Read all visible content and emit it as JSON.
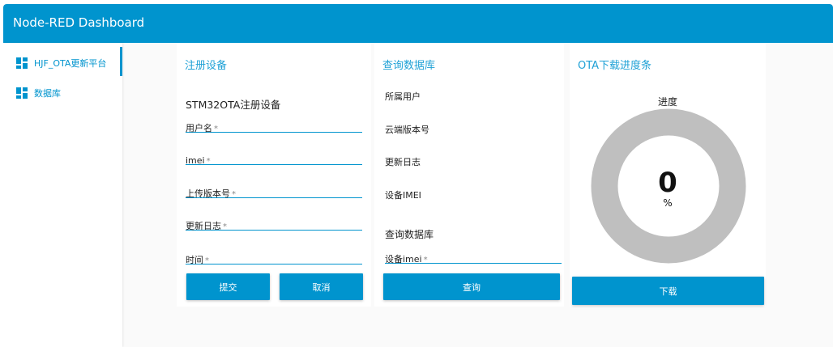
{
  "header": {
    "title": "Node-RED Dashboard"
  },
  "sidebar": {
    "items": [
      {
        "label": "HJF_OTA更新平台",
        "icon": "dashboard-icon",
        "active": true
      },
      {
        "label": "数据库",
        "icon": "dashboard-icon",
        "active": false
      }
    ]
  },
  "register": {
    "title": "注册设备",
    "form_heading": "STM32OTA注册设备",
    "fields": [
      {
        "label": "用户名",
        "required": "*",
        "value": ""
      },
      {
        "label": "imei",
        "required": "*",
        "value": ""
      },
      {
        "label": "上传版本号",
        "required": "*",
        "value": ""
      },
      {
        "label": "更新日志",
        "required": "*",
        "value": ""
      },
      {
        "label": "时间",
        "required": "*",
        "value": ""
      }
    ],
    "submit_label": "提交",
    "cancel_label": "取消"
  },
  "query": {
    "title": "查询数据库",
    "rows": [
      "所属用户",
      "云端版本号",
      "更新日志",
      "设备IMEI"
    ],
    "form_heading": "查询数据库",
    "field": {
      "label": "设备imei",
      "required": "*",
      "value": ""
    },
    "button_label": "查询"
  },
  "ota": {
    "title": "OTA下载进度条",
    "gauge_title": "进度",
    "value": "0",
    "unit": "%",
    "progress_fraction": 0,
    "button_label": "下载"
  },
  "colors": {
    "accent": "#0094ce",
    "title_text": "#1fa1d6",
    "gauge_track": "#bfbfbf"
  }
}
